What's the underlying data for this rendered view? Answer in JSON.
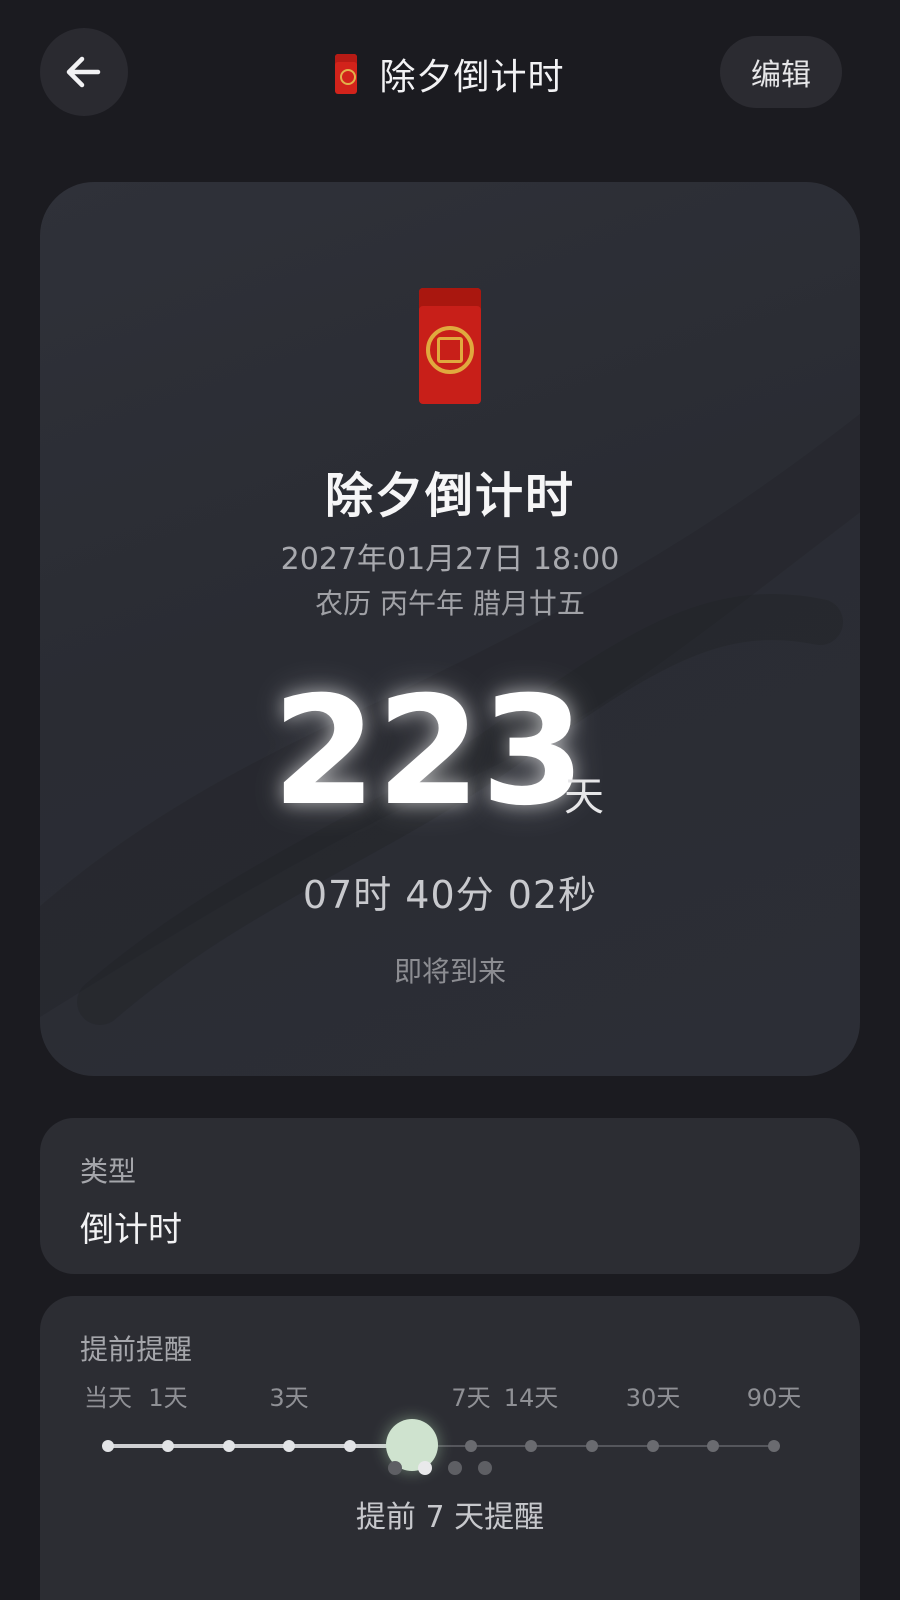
{
  "header": {
    "back_icon": "arrow-left-icon",
    "title": "除夕倒计时",
    "title_icon": "red-envelope-icon",
    "edit_label": "编辑"
  },
  "event": {
    "icon": "red-envelope-icon",
    "title": "除夕倒计时",
    "date": "2027年01月27日 18:00",
    "lunar": "农历 丙午年 腊月廿五",
    "days": "223",
    "days_unit": "天",
    "hms": "07时 40分 02秒",
    "status": "即将到来"
  },
  "type": {
    "label": "类型",
    "value": "倒计时"
  },
  "reminder": {
    "label": "提前提醒",
    "ticks": [
      "当天",
      "1天",
      "3天",
      "7天",
      "14天",
      "30天",
      "90天"
    ],
    "selected_index": 4,
    "selected_label": "提前 7 天提醒",
    "accent_color": "#cfe3cf",
    "page_count": 4,
    "page_active": 1
  }
}
